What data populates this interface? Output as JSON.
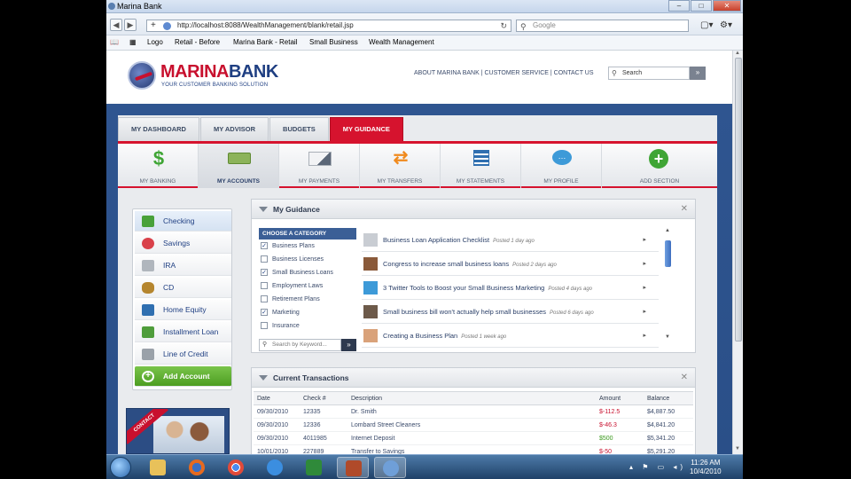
{
  "window": {
    "title": "Marina Bank"
  },
  "browser": {
    "url": "http://localhost:8088/WealthManagement/blank/retail.jsp",
    "search_placeholder": "Google",
    "bookmarks": [
      "Logo",
      "Retail - Before",
      "Marina Bank - Retail",
      "Small Business",
      "Wealth Management"
    ]
  },
  "header": {
    "brand_a": "MARINA",
    "brand_b": "BANK",
    "tagline": "YOUR CUSTOMER BANKING SOLUTION",
    "links": "ABOUT MARINA BANK | CUSTOMER SERVICE | CONTACT US",
    "search_placeholder": "Search"
  },
  "main_tabs": [
    {
      "label": "MY DASHBOARD"
    },
    {
      "label": "MY ADVISOR"
    },
    {
      "label": "BUDGETS"
    },
    {
      "label": "MY GUIDANCE",
      "active": true
    }
  ],
  "sub_nav": [
    {
      "label": "MY BANKING",
      "icon": "dollar-icon",
      "color": "#3fa535"
    },
    {
      "label": "MY ACCOUNTS",
      "icon": "cash-icon",
      "color": "#7fa34a",
      "active": true
    },
    {
      "label": "MY PAYMENTS",
      "icon": "pen-paper-icon",
      "color": "#5a6677"
    },
    {
      "label": "MY TRANSFERS",
      "icon": "arrows-icon",
      "color": "#f08a1d"
    },
    {
      "label": "MY STATEMENTS",
      "icon": "statement-icon",
      "color": "#2f6fb0"
    },
    {
      "label": "MY PROFILE",
      "icon": "chat-bubble-icon",
      "color": "#3d9ad8"
    },
    {
      "label": "ADD SECTION",
      "icon": "plus-circle-icon",
      "color": "#3fa535"
    }
  ],
  "sidebar": [
    {
      "label": "Checking",
      "icon": "checkmark-icon",
      "color": "#48a13a"
    },
    {
      "label": "Savings",
      "icon": "piggy-bank-icon",
      "color": "#d9414a"
    },
    {
      "label": "IRA",
      "icon": "chart-icon",
      "color": "#b0b6bd"
    },
    {
      "label": "CD",
      "icon": "money-bag-icon",
      "color": "#b5862f"
    },
    {
      "label": "Home Equity",
      "icon": "house-icon",
      "color": "#2f6fb0"
    },
    {
      "label": "Installment Loan",
      "icon": "bill-icon",
      "color": "#4f9d3b"
    },
    {
      "label": "Line of Credit",
      "icon": "calculator-icon",
      "color": "#9aa1a9"
    },
    {
      "label": "Add Account",
      "icon": "plus-icon",
      "color": "#ffffff"
    }
  ],
  "contact_banner": {
    "ribbon": "CONTACT"
  },
  "guidance": {
    "title": "My Guidance",
    "category_header": "CHOOSE A CATEGORY",
    "categories": [
      {
        "label": "Business Plans",
        "checked": true
      },
      {
        "label": "Business Licenses",
        "checked": false
      },
      {
        "label": "Small Business Loans",
        "checked": true
      },
      {
        "label": "Employment Laws",
        "checked": false
      },
      {
        "label": "Retirement Plans",
        "checked": false
      },
      {
        "label": "Marketing",
        "checked": true
      },
      {
        "label": "Insurance",
        "checked": false
      }
    ],
    "keyword_placeholder": "Search by Keyword...",
    "articles": [
      {
        "title": "Business Loan Application Checklist",
        "posted": "Posted 1 day ago",
        "color": "#c9cdd3"
      },
      {
        "title": "Congress to increase small business loans",
        "posted": "Posted 2 days ago",
        "color": "#8a5a3a"
      },
      {
        "title": "3 Twitter Tools to Boost your Small Business Marketing",
        "posted": "Posted 4 days ago",
        "color": "#3d9ad8"
      },
      {
        "title": "Small business bill won't actually help small businesses",
        "posted": "Posted 6 days ago",
        "color": "#6d5a4a"
      },
      {
        "title": "Creating a Business Plan",
        "posted": "Posted 1 week ago",
        "color": "#d9a27a"
      }
    ]
  },
  "transactions": {
    "title": "Current Transactions",
    "columns": [
      "Date",
      "Check #",
      "Description",
      "Amount",
      "Balance"
    ],
    "rows": [
      [
        "09/30/2010",
        "12335",
        "Dr. Smith",
        "$-112.5",
        "$4,887.50"
      ],
      [
        "09/30/2010",
        "12336",
        "Lombard Street Cleaners",
        "$-46.3",
        "$4,841.20"
      ],
      [
        "09/30/2010",
        "4011985",
        "Internet Deposit",
        "$500",
        "$5,341.20"
      ],
      [
        "10/01/2010",
        "227889",
        "Transfer to Savings",
        "$-50",
        "$5,291.20"
      ]
    ]
  },
  "taskbar": {
    "time": "11:26 AM",
    "date": "10/4/2010"
  }
}
